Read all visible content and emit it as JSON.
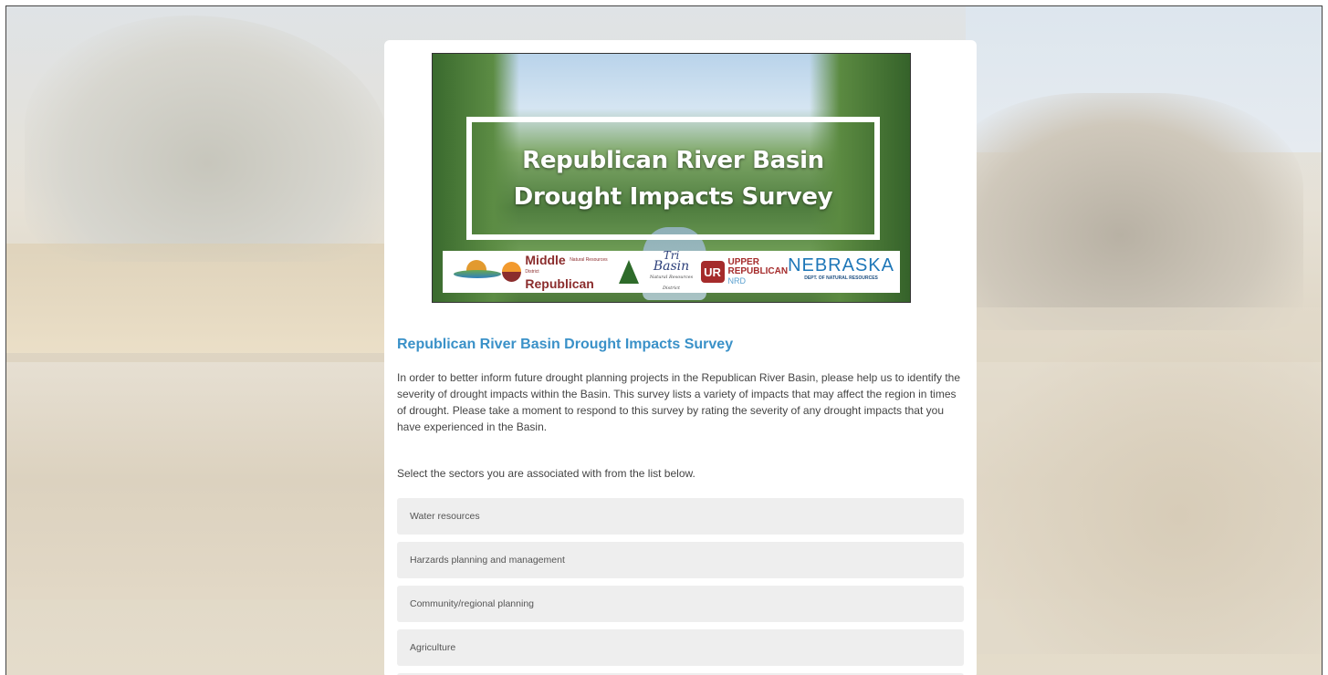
{
  "banner": {
    "title_line1": "Republican River Basin",
    "title_line2": "Drought Impacts Survey",
    "logos": {
      "middle": {
        "line1": "Middle",
        "line2": "Republican",
        "tiny": "Natural Resources District"
      },
      "tribasin": {
        "line1": "Tri",
        "line2": "Basin",
        "line3": "Natural Resources District"
      },
      "upper": {
        "badge": "UR",
        "line1": "UPPER",
        "line2": "REPUBLICAN",
        "line3": "NRD"
      },
      "nebraska": {
        "line1": "NEBRASKA",
        "line2": "DEPT. OF NATURAL RESOURCES"
      }
    }
  },
  "survey": {
    "title": "Republican River Basin Drought Impacts Survey",
    "intro": "In order to better inform future drought planning projects in the Republican River Basin, please help us to identify the severity of drought impacts within the Basin. This survey lists a variety of impacts that may affect the region in times of drought. Please take a moment to respond to this survey by rating the severity of any drought impacts that you have experienced in the Basin.",
    "prompt": "Select the sectors you are associated with from the list below.",
    "options": [
      "Water resources",
      "Harzards planning and management",
      "Community/regional planning",
      "Agriculture"
    ]
  }
}
